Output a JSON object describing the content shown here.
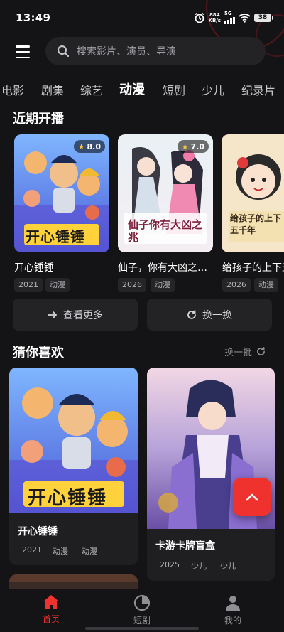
{
  "status_bar": {
    "time": "13:49",
    "network_speed_value": "884",
    "network_speed_unit": "KB/s",
    "signal_type": "5G",
    "battery": "38"
  },
  "search": {
    "placeholder": "搜索影片、演员、导演"
  },
  "tabs": [
    {
      "label": "电影",
      "active": false
    },
    {
      "label": "剧集",
      "active": false
    },
    {
      "label": "综艺",
      "active": false
    },
    {
      "label": "动漫",
      "active": true
    },
    {
      "label": "短剧",
      "active": false
    },
    {
      "label": "少儿",
      "active": false
    },
    {
      "label": "纪录片",
      "active": false
    }
  ],
  "recent": {
    "title": "近期开播",
    "items": [
      {
        "title": "开心锤锤",
        "rating": "8.0",
        "year": "2021",
        "genre": "动漫",
        "poster_text": "开心锤锤"
      },
      {
        "title": "仙子，你有大凶之…",
        "rating": "7.0",
        "year": "2026",
        "genre": "动漫",
        "poster_text": "仙子你有大凶之兆"
      },
      {
        "title": "给孩子的上下五千年",
        "rating": "",
        "year": "2026",
        "genre": "动漫",
        "poster_text": "给孩子的上下五千年"
      }
    ],
    "more_label": "查看更多",
    "refresh_label": "换一换"
  },
  "guess": {
    "title": "猜你喜欢",
    "action_label": "换一批",
    "items": [
      {
        "title": "开心锤锤",
        "year": "2021",
        "tags": [
          "动漫",
          "动漫"
        ],
        "poster_text": "开心锤锤"
      },
      {
        "title": "卡游卡牌盲盒",
        "year": "2025",
        "tags": [
          "少儿",
          "少儿"
        ]
      }
    ]
  },
  "bottom_nav": [
    {
      "label": "首页",
      "icon": "home-icon",
      "active": true
    },
    {
      "label": "短剧",
      "icon": "pie-chart-icon",
      "active": false
    },
    {
      "label": "我的",
      "icon": "user-icon",
      "active": false
    }
  ],
  "colors": {
    "background": "#141416",
    "accent": "#f0322e",
    "card": "#1f1f22",
    "chip": "#252528",
    "rating_star": "#f6c344"
  }
}
